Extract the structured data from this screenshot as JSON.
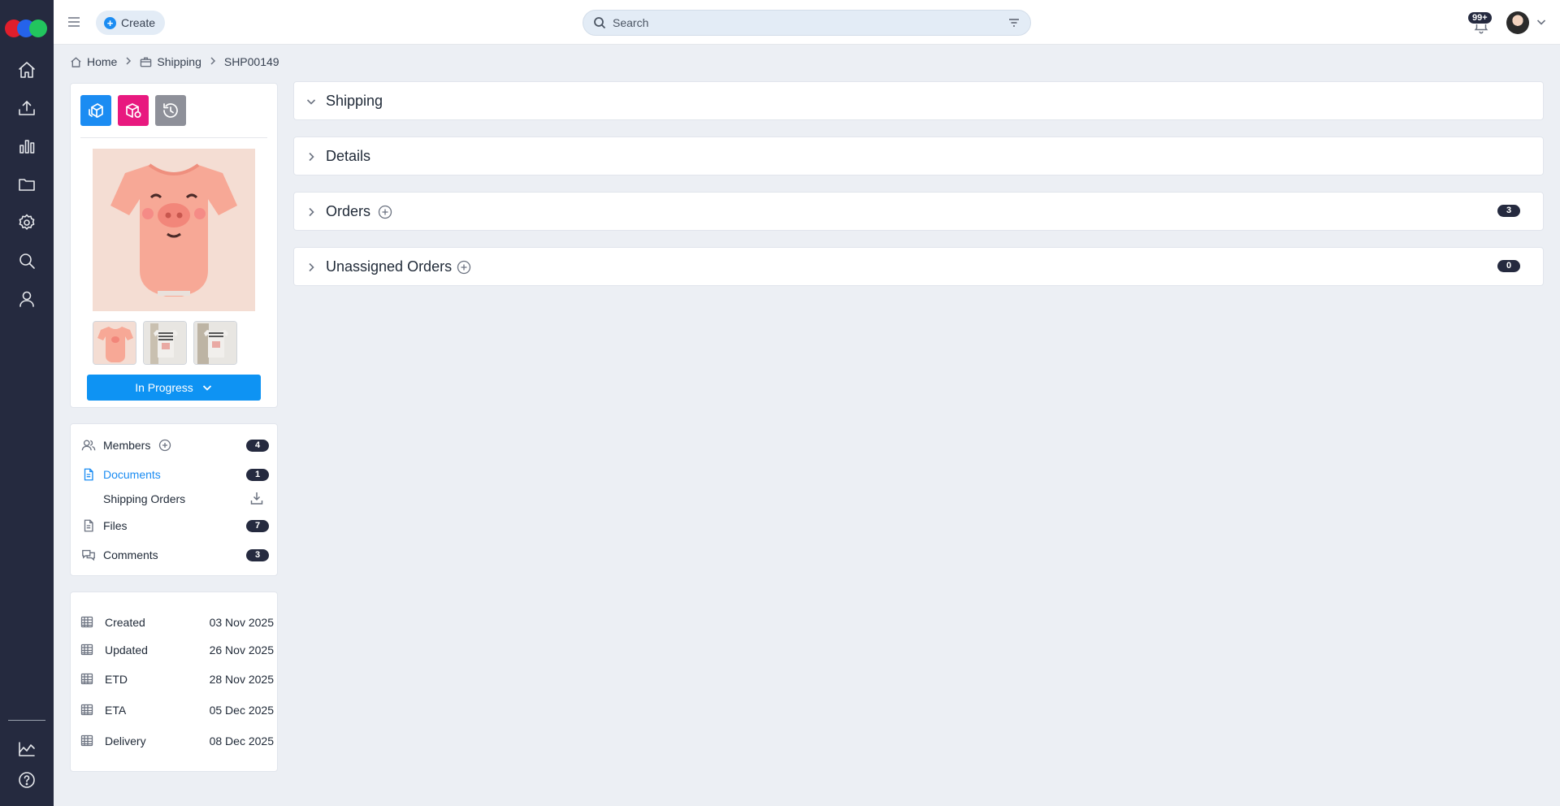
{
  "topbar": {
    "create_label": "Create",
    "search_placeholder": "Search",
    "notification_count": "99+"
  },
  "breadcrumb": {
    "home": "Home",
    "shipping": "Shipping",
    "current": "SHP00149"
  },
  "status": {
    "label": "In Progress"
  },
  "nav": {
    "members": {
      "label": "Members",
      "count": "4"
    },
    "documents": {
      "label": "Documents",
      "count": "1"
    },
    "shipping_orders": {
      "label": "Shipping Orders"
    },
    "files": {
      "label": "Files",
      "count": "7"
    },
    "comments": {
      "label": "Comments",
      "count": "3"
    }
  },
  "dates": [
    {
      "label": "Created",
      "value": "03 Nov 2025"
    },
    {
      "label": "Updated",
      "value": "26 Nov 2025"
    },
    {
      "label": "ETD",
      "value": "28 Nov 2025"
    },
    {
      "label": "ETA",
      "value": "05 Dec 2025"
    },
    {
      "label": "Delivery",
      "value": "08 Dec 2025"
    }
  ],
  "sections": [
    {
      "title": "Shipping"
    },
    {
      "title": "Details"
    },
    {
      "title": "Orders",
      "count": "3"
    },
    {
      "title": "Unassigned Orders",
      "count": "0"
    }
  ],
  "colors": {
    "rail": "#252a3f",
    "accent": "#1b8cf2",
    "status": "#0e93f3",
    "tool_pink": "#e8197f",
    "tool_grey": "#8e9099"
  }
}
